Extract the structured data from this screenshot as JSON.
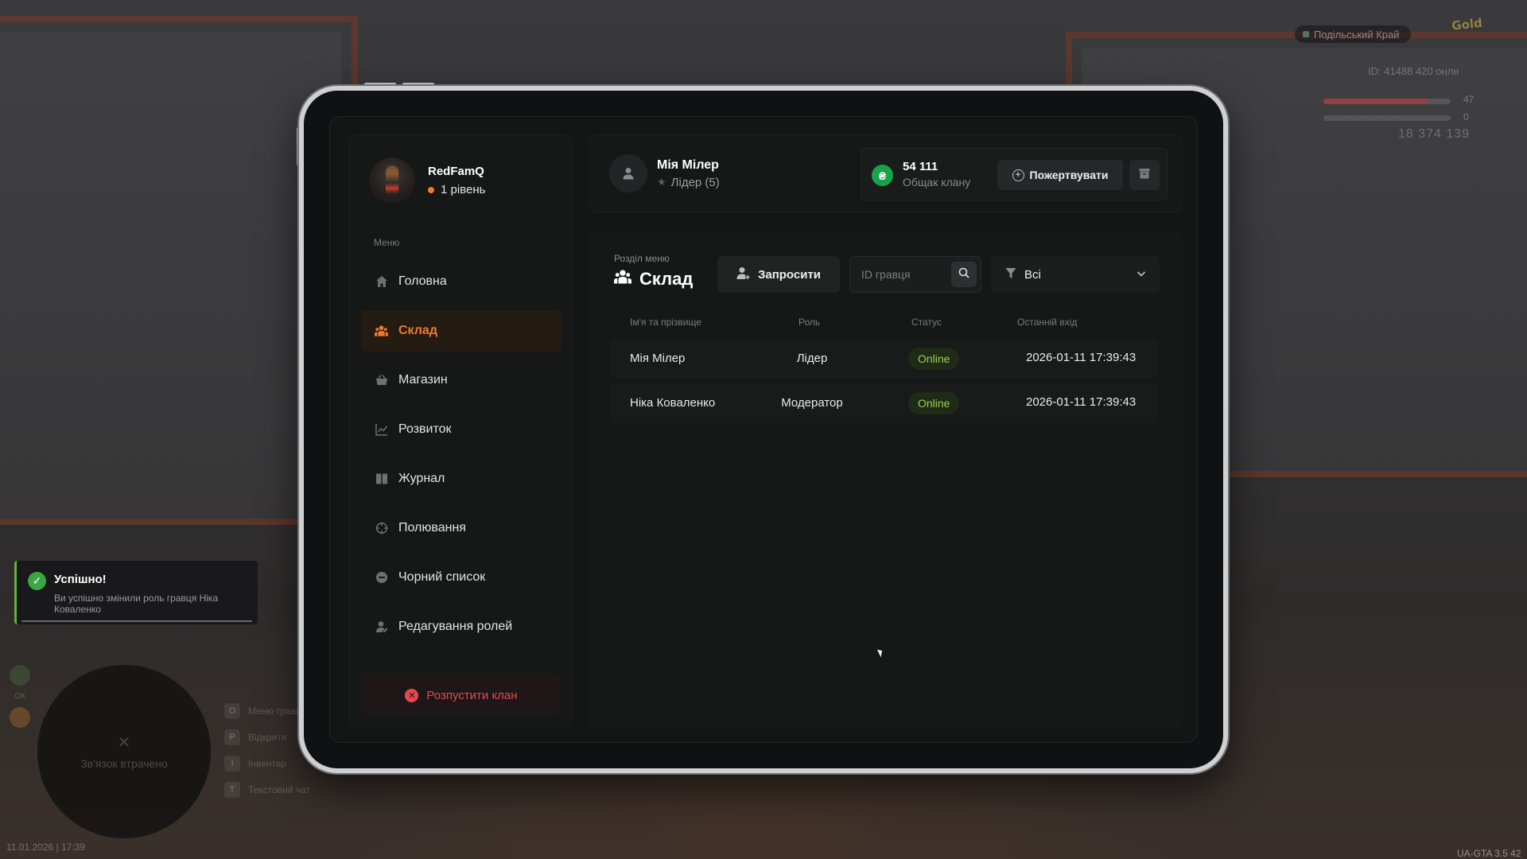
{
  "hud": {
    "region": "Подільський Край",
    "logo": "Gold",
    "stats": "ID: 41488  420 онлн",
    "health_value": "47",
    "armor_value": "0",
    "money": "18 374 139",
    "minimap_text": "Зв'язок втрачено",
    "keyhints": [
      {
        "key": "O",
        "label": "Меню гравця"
      },
      {
        "key": "P",
        "label": "Відкрити"
      },
      {
        "key": "I",
        "label": "Інвентар"
      },
      {
        "key": "T",
        "label": "Текстовий чат"
      }
    ],
    "side_label": "ОК",
    "datetime": "11.01.2026 | 17:39",
    "version": "UA-GTA 3.5",
    "version_extra": "42"
  },
  "toast": {
    "title": "Успішно!",
    "message": "Ви успішно змінили роль гравця Ніка Коваленко",
    "progress": 0.98
  },
  "sidebar": {
    "profile": {
      "name": "RedFamQ",
      "level": "1 рівень"
    },
    "menu_label": "Меню",
    "items": [
      {
        "label": "Головна",
        "icon": "home-icon",
        "active": false
      },
      {
        "label": "Склад",
        "icon": "users-icon",
        "active": true
      },
      {
        "label": "Магазин",
        "icon": "basket-icon",
        "active": false
      },
      {
        "label": "Розвиток",
        "icon": "chart-icon",
        "active": false
      },
      {
        "label": "Журнал",
        "icon": "book-icon",
        "active": false
      },
      {
        "label": "Полювання",
        "icon": "crosshair-icon",
        "active": false
      },
      {
        "label": "Чорний список",
        "icon": "blocked-icon",
        "active": false
      },
      {
        "label": "Редагування ролей",
        "icon": "user-edit-icon",
        "active": false
      }
    ],
    "disband_label": "Розпустити клан"
  },
  "topbar": {
    "user_name": "Мія Мілер",
    "user_role": "Лідер (5)",
    "bank_amount": "54 111",
    "bank_label": "Общак клану",
    "donate_label": "Пожертвувати"
  },
  "main": {
    "caption": "Розділ меню",
    "title": "Склад",
    "invite_label": "Запросити",
    "search_placeholder": "ID гравця",
    "filter_value": "Всі",
    "columns": [
      "Ім'я та прізвище",
      "Роль",
      "Статус",
      "Останній вхід"
    ],
    "rows": [
      {
        "name": "Мія Мілер",
        "role": "Лідер",
        "status": "Online",
        "last_login": "2026-01-11 17:39:43"
      },
      {
        "name": "Ніка Коваленко",
        "role": "Модератор",
        "status": "Online",
        "last_login": "2026-01-11 17:39:43"
      }
    ]
  },
  "colors": {
    "accent": "#f07a2c",
    "online": "#9ad14b",
    "danger": "#e5484d",
    "coin": "#17a34a",
    "success": "#3aa842"
  }
}
